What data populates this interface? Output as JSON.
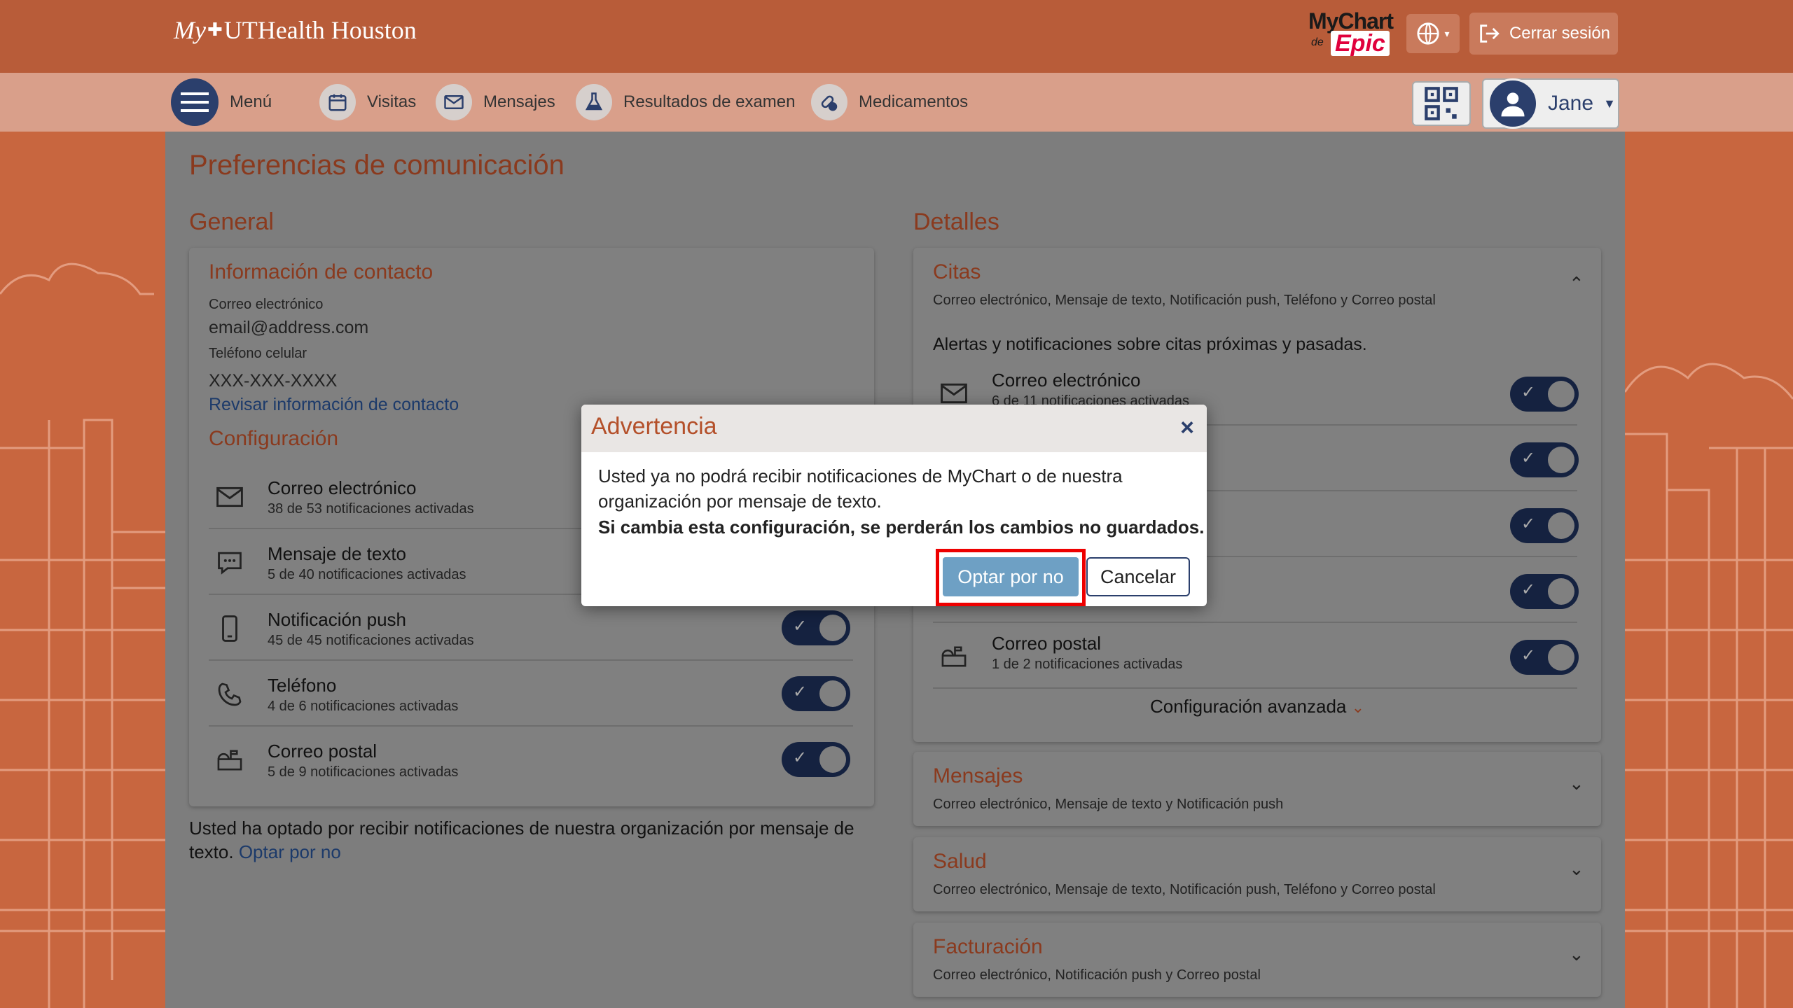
{
  "header": {
    "logo_my": "My",
    "logo_brand": "UTHealth Houston",
    "mychart_line1": "MyChart",
    "mychart_de": "de",
    "mychart_epic": "Epic",
    "logout_label": "Cerrar sesión"
  },
  "nav": {
    "menu_label": "Menú",
    "items": [
      {
        "label": "Visitas",
        "icon": "calendar-icon"
      },
      {
        "label": "Mensajes",
        "icon": "envelope-icon"
      },
      {
        "label": "Resultados de examen",
        "icon": "flask-icon"
      },
      {
        "label": "Medicamentos",
        "icon": "pills-icon"
      }
    ],
    "user_name": "Jane"
  },
  "page": {
    "title": "Preferencias de comunicación",
    "general_title": "General",
    "details_title": "Detalles"
  },
  "contact": {
    "title": "Información de contacto",
    "email_label": "Correo electrónico",
    "email_value": "email@address.com",
    "phone_label": "Teléfono celular",
    "phone_value": "XXX-XXX-XXXX",
    "review_link": "Revisar información de contacto"
  },
  "config": {
    "title": "Configuración",
    "items": [
      {
        "title": "Correo electrónico",
        "sub": "38 de 53 notificaciones activadas"
      },
      {
        "title": "Mensaje de texto",
        "sub": "5 de 40 notificaciones activadas"
      },
      {
        "title": "Notificación push",
        "sub": "45 de 45 notificaciones activadas"
      },
      {
        "title": "Teléfono",
        "sub": "4 de 6 notificaciones activadas"
      },
      {
        "title": "Correo postal",
        "sub": "5 de 9 notificaciones activadas"
      }
    ],
    "optout_text": "Usted ha optado por recibir notificaciones de nuestra organización por mensaje de texto.",
    "optout_link": "Optar por no"
  },
  "citas": {
    "title": "Citas",
    "channels": "Correo electrónico, Mensaje de texto, Notificación push, Teléfono y Correo postal",
    "desc": "Alertas y notificaciones sobre citas próximas y pasadas.",
    "email_title": "Correo electrónico",
    "email_sub": "6 de 11 notificaciones activadas",
    "postal_title": "Correo postal",
    "postal_sub": "1 de 2 notificaciones activadas",
    "advanced": "Configuración avanzada"
  },
  "mensajes": {
    "title": "Mensajes",
    "channels": "Correo electrónico, Mensaje de texto y Notificación push"
  },
  "salud": {
    "title": "Salud",
    "channels": "Correo electrónico, Mensaje de texto, Notificación push, Teléfono y Correo postal"
  },
  "facturacion": {
    "title": "Facturación",
    "channels": "Correo electrónico, Notificación push y Correo postal"
  },
  "modal": {
    "title": "Advertencia",
    "close": "×",
    "text": "Usted ya no podrá recibir notificaciones de MyChart o de nuestra organización por mensaje de texto.",
    "warning": "Si cambia esta configuración, se perderán los cambios no guardados.",
    "confirm_label": "Optar por no",
    "cancel_label": "Cancelar"
  },
  "toggle_check": "✓"
}
